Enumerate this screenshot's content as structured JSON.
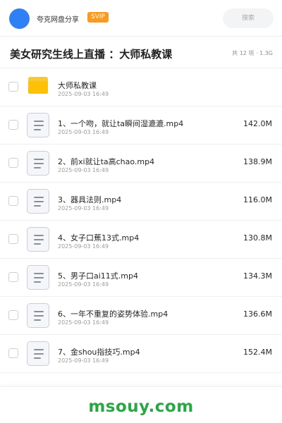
{
  "header": {
    "username": "夸克网盘分享",
    "badge": "SVIP",
    "search_placeholder": "搜索"
  },
  "folder": {
    "title": "美女研究生线上直播 ：大师私教课",
    "summary": "共 12 项 · 1.3G"
  },
  "items": [
    {
      "type": "folder",
      "icon": "folder-icon",
      "name": "大师私教课",
      "date": "2025-09-03 16:49",
      "size": ""
    },
    {
      "type": "file",
      "icon": "file-icon",
      "name": "1、一个吻，就让ta瞬间湿漉漉.mp4",
      "date": "2025-09-03 16:49",
      "size": "142.0M"
    },
    {
      "type": "file",
      "icon": "file-icon",
      "name": "2、前xi就让ta高chao.mp4",
      "date": "2025-09-03 16:49",
      "size": "138.9M"
    },
    {
      "type": "file",
      "icon": "file-icon",
      "name": "3、器具法则.mp4",
      "date": "2025-09-03 16:49",
      "size": "116.0M"
    },
    {
      "type": "file",
      "icon": "file-icon",
      "name": "4、女子口蕉13式.mp4",
      "date": "2025-09-03 16:49",
      "size": "130.8M"
    },
    {
      "type": "file",
      "icon": "file-icon",
      "name": "5、男子口ai11式.mp4",
      "date": "2025-09-03 16:49",
      "size": "134.3M"
    },
    {
      "type": "file",
      "icon": "file-icon",
      "name": "6、一年不重复的姿势体验.mp4",
      "date": "2025-09-03 16:49",
      "size": "136.6M"
    },
    {
      "type": "file",
      "icon": "file-icon",
      "name": "7、金shou指技巧.mp4",
      "date": "2025-09-03 16:49",
      "size": "152.4M"
    }
  ],
  "watermark": "msouy.com",
  "colors": {
    "avatar": "#2f80f5",
    "svip_badge": "#fa9a1e",
    "folder": "#ffc107",
    "watermark": "#2aa745"
  }
}
